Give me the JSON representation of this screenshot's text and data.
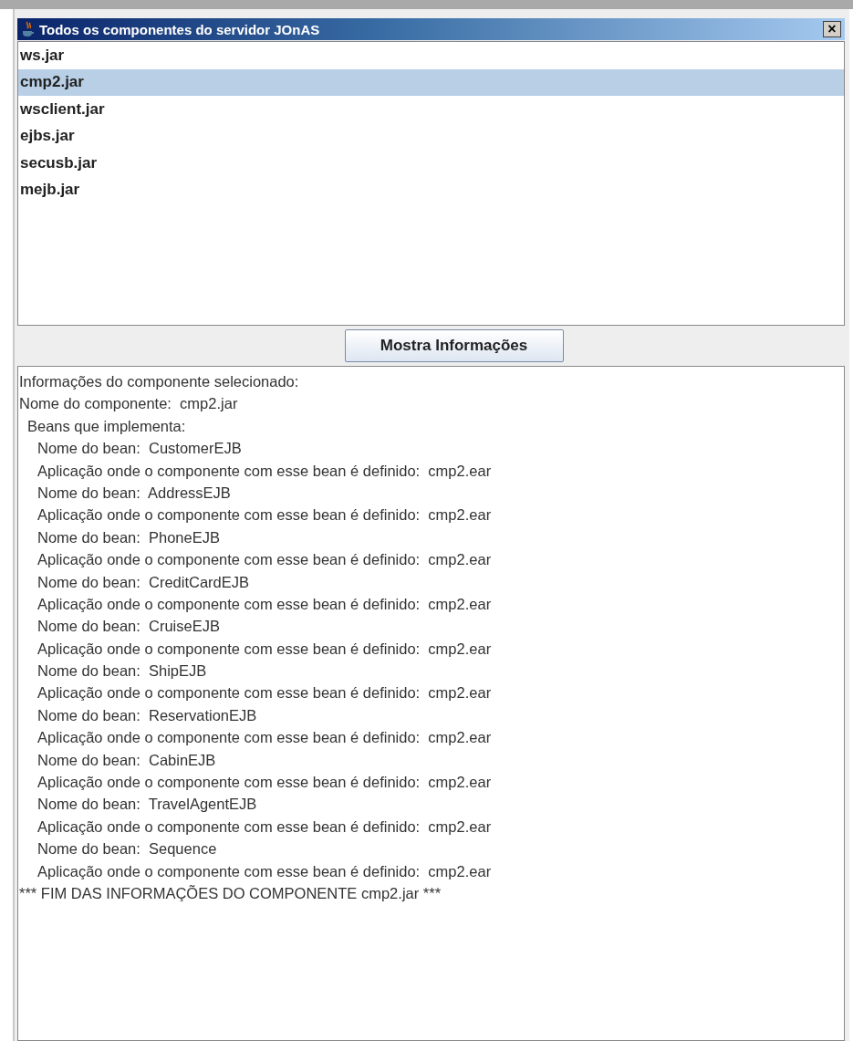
{
  "window": {
    "title": "Todos os componentes do servidor JOnAS",
    "close_label": "×"
  },
  "components": [
    {
      "name": "ws.jar",
      "selected": false
    },
    {
      "name": "cmp2.jar",
      "selected": true
    },
    {
      "name": "wsclient.jar",
      "selected": false
    },
    {
      "name": "ejbs.jar",
      "selected": false
    },
    {
      "name": "secusb.jar",
      "selected": false
    },
    {
      "name": "mejb.jar",
      "selected": false
    }
  ],
  "button": {
    "label": "Mostra Informações"
  },
  "info_lines": [
    {
      "kind": "header",
      "text": "Informações do componente selecionado:"
    },
    {
      "kind": "header",
      "text": "Nome do componente:  cmp2.jar"
    },
    {
      "kind": "section",
      "text": "Beans que implementa:"
    },
    {
      "kind": "detail",
      "text": "Nome do bean:  CustomerEJB"
    },
    {
      "kind": "detail",
      "text": "Aplicação onde o componente com esse bean é definido:  cmp2.ear"
    },
    {
      "kind": "detail",
      "text": "Nome do bean:  AddressEJB"
    },
    {
      "kind": "detail",
      "text": "Aplicação onde o componente com esse bean é definido:  cmp2.ear"
    },
    {
      "kind": "detail",
      "text": "Nome do bean:  PhoneEJB"
    },
    {
      "kind": "detail",
      "text": "Aplicação onde o componente com esse bean é definido:  cmp2.ear"
    },
    {
      "kind": "detail",
      "text": "Nome do bean:  CreditCardEJB"
    },
    {
      "kind": "detail",
      "text": "Aplicação onde o componente com esse bean é definido:  cmp2.ear"
    },
    {
      "kind": "detail",
      "text": "Nome do bean:  CruiseEJB"
    },
    {
      "kind": "detail",
      "text": "Aplicação onde o componente com esse bean é definido:  cmp2.ear"
    },
    {
      "kind": "detail",
      "text": "Nome do bean:  ShipEJB"
    },
    {
      "kind": "detail",
      "text": "Aplicação onde o componente com esse bean é definido:  cmp2.ear"
    },
    {
      "kind": "detail",
      "text": "Nome do bean:  ReservationEJB"
    },
    {
      "kind": "detail",
      "text": "Aplicação onde o componente com esse bean é definido:  cmp2.ear"
    },
    {
      "kind": "detail",
      "text": "Nome do bean:  CabinEJB"
    },
    {
      "kind": "detail",
      "text": "Aplicação onde o componente com esse bean é definido:  cmp2.ear"
    },
    {
      "kind": "detail",
      "text": "Nome do bean:  TravelAgentEJB"
    },
    {
      "kind": "detail",
      "text": "Aplicação onde o componente com esse bean é definido:  cmp2.ear"
    },
    {
      "kind": "detail",
      "text": "Nome do bean:  Sequence"
    },
    {
      "kind": "detail",
      "text": "Aplicação onde o componente com esse bean é definido:  cmp2.ear"
    },
    {
      "kind": "header",
      "text": "*** FIM DAS INFORMAÇÕES DO COMPONENTE cmp2.jar ***"
    }
  ]
}
